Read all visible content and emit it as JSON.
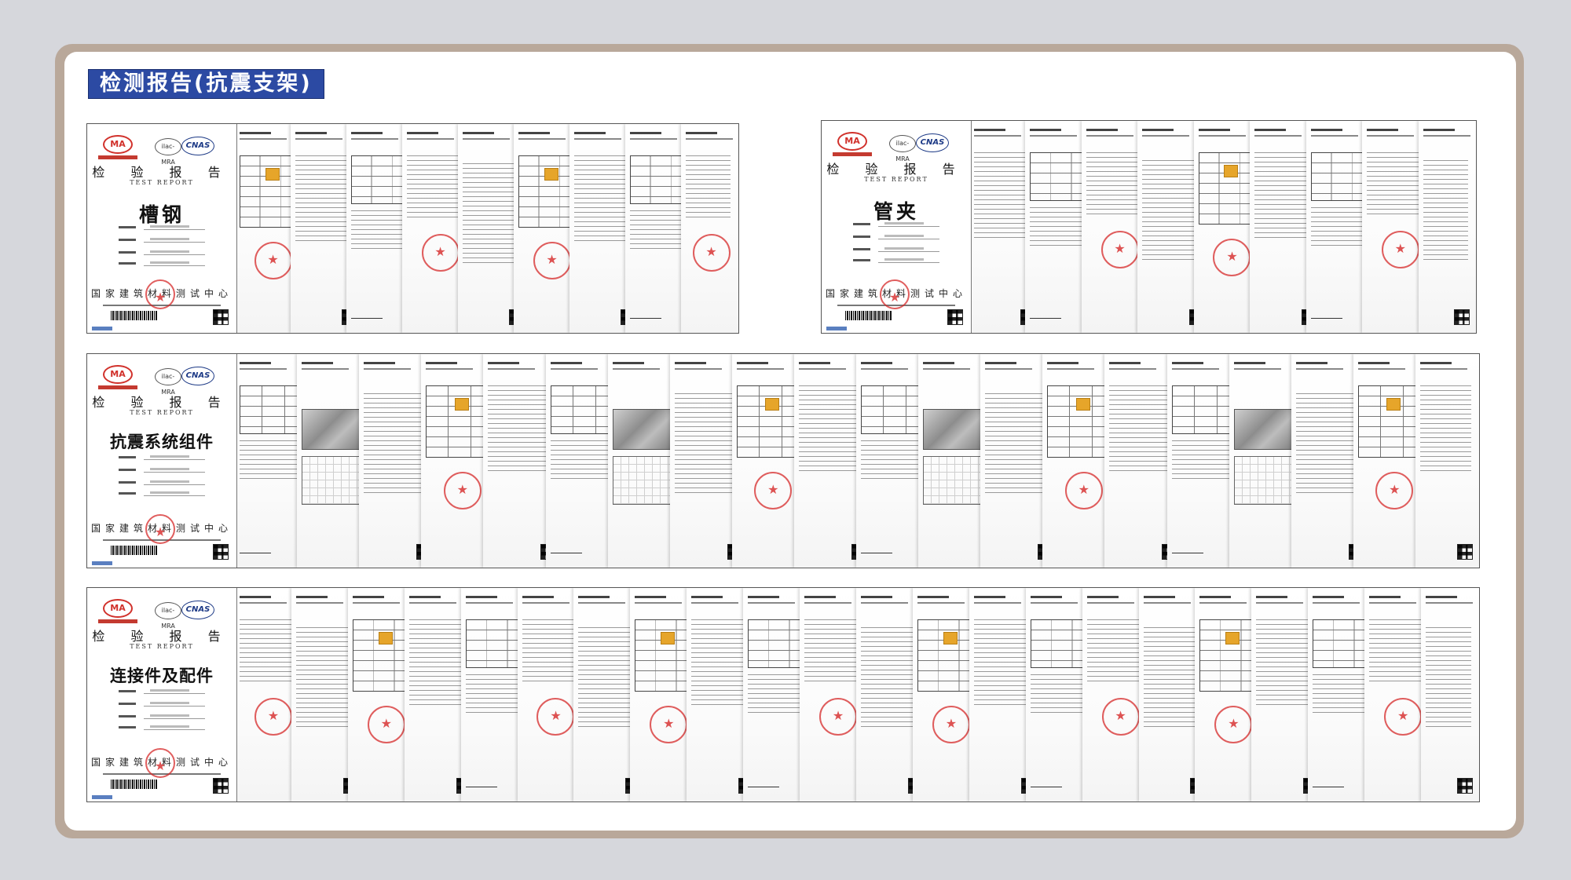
{
  "board_title": "检测报告(抗震支架)",
  "cover_common": {
    "ma_logo": "MA",
    "ilac_logo": "ilac-MRA",
    "cnas_logo": "CNAS",
    "report_title": "检 验 报 告",
    "report_title_en": "TEST REPORT",
    "issuer": "国家建筑材料测试中心"
  },
  "groups": [
    {
      "product": "槽钢",
      "pages": 9
    },
    {
      "product": "管夹",
      "pages": 9
    },
    {
      "product": "抗震系统组件",
      "pages": 20
    },
    {
      "product": "连接件及配件",
      "pages": 22
    }
  ],
  "colors": {
    "title_bar": "#2c4aa3",
    "frame": "#b9a89a",
    "seal_red": "#d62828",
    "cnas_blue": "#1d3a86"
  }
}
